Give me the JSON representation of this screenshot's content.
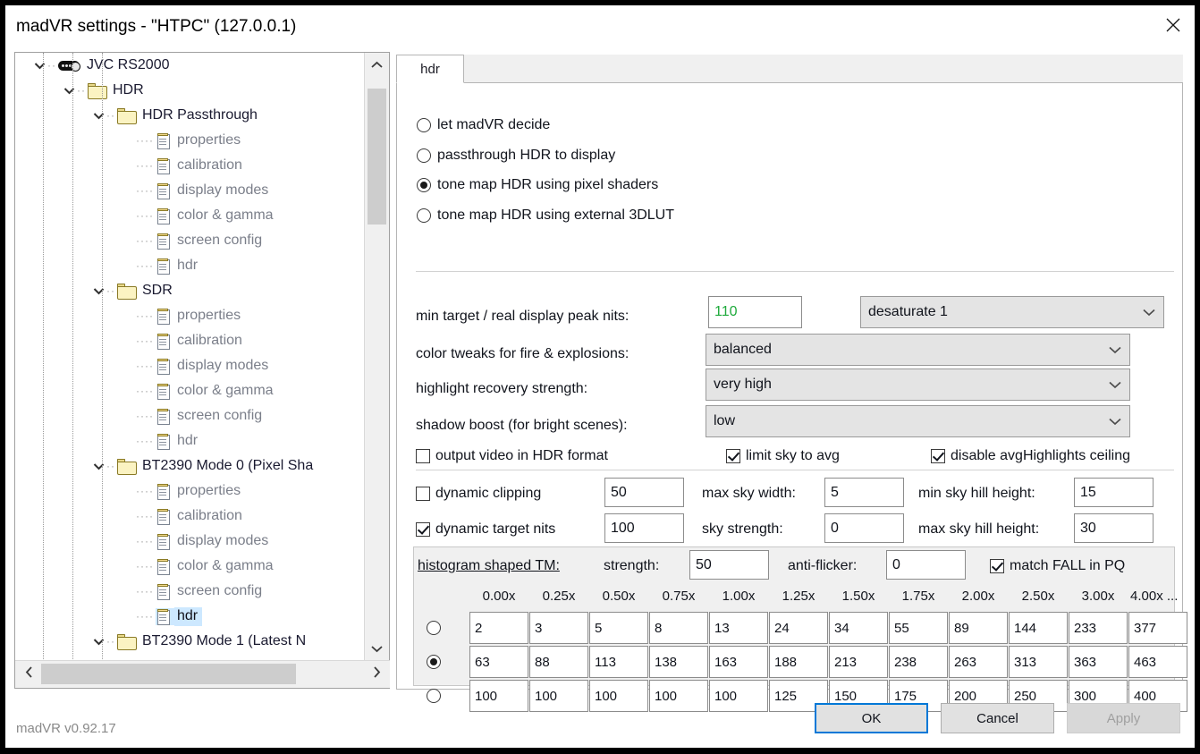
{
  "window": {
    "title": "madVR settings - \"HTPC\" (127.0.0.1)",
    "close_icon": "close-icon"
  },
  "tree": {
    "items": [
      {
        "label": "JVC RS2000",
        "depth": 1,
        "icon": "projector-icon",
        "expanded": true,
        "type": "device",
        "selected": false
      },
      {
        "label": "HDR",
        "depth": 2,
        "icon": "folder-icon",
        "expanded": true,
        "type": "folder",
        "selected": false
      },
      {
        "label": "HDR Passthrough",
        "depth": 3,
        "icon": "folder-icon",
        "expanded": true,
        "type": "folder",
        "selected": false
      },
      {
        "label": "properties",
        "depth": 4,
        "icon": "document-icon",
        "expanded": null,
        "type": "leaf",
        "selected": false
      },
      {
        "label": "calibration",
        "depth": 4,
        "icon": "document-icon",
        "expanded": null,
        "type": "leaf",
        "selected": false
      },
      {
        "label": "display modes",
        "depth": 4,
        "icon": "document-icon",
        "expanded": null,
        "type": "leaf",
        "selected": false
      },
      {
        "label": "color & gamma",
        "depth": 4,
        "icon": "document-icon",
        "expanded": null,
        "type": "leaf",
        "selected": false
      },
      {
        "label": "screen config",
        "depth": 4,
        "icon": "document-icon",
        "expanded": null,
        "type": "leaf",
        "selected": false
      },
      {
        "label": "hdr",
        "depth": 4,
        "icon": "document-icon",
        "expanded": null,
        "type": "leaf",
        "selected": false
      },
      {
        "label": "SDR",
        "depth": 3,
        "icon": "folder-icon",
        "expanded": true,
        "type": "folder",
        "selected": false
      },
      {
        "label": "properties",
        "depth": 4,
        "icon": "document-icon",
        "expanded": null,
        "type": "leaf",
        "selected": false
      },
      {
        "label": "calibration",
        "depth": 4,
        "icon": "document-icon",
        "expanded": null,
        "type": "leaf",
        "selected": false
      },
      {
        "label": "display modes",
        "depth": 4,
        "icon": "document-icon",
        "expanded": null,
        "type": "leaf",
        "selected": false
      },
      {
        "label": "color & gamma",
        "depth": 4,
        "icon": "document-icon",
        "expanded": null,
        "type": "leaf",
        "selected": false
      },
      {
        "label": "screen config",
        "depth": 4,
        "icon": "document-icon",
        "expanded": null,
        "type": "leaf",
        "selected": false
      },
      {
        "label": "hdr",
        "depth": 4,
        "icon": "document-icon",
        "expanded": null,
        "type": "leaf",
        "selected": false
      },
      {
        "label": "BT2390 Mode 0 (Pixel Sha",
        "depth": 3,
        "icon": "folder-icon",
        "expanded": true,
        "type": "folder",
        "selected": false
      },
      {
        "label": "properties",
        "depth": 4,
        "icon": "document-icon",
        "expanded": null,
        "type": "leaf",
        "selected": false
      },
      {
        "label": "calibration",
        "depth": 4,
        "icon": "document-icon",
        "expanded": null,
        "type": "leaf",
        "selected": false
      },
      {
        "label": "display modes",
        "depth": 4,
        "icon": "document-icon",
        "expanded": null,
        "type": "leaf",
        "selected": false
      },
      {
        "label": "color & gamma",
        "depth": 4,
        "icon": "document-icon",
        "expanded": null,
        "type": "leaf",
        "selected": false
      },
      {
        "label": "screen config",
        "depth": 4,
        "icon": "document-icon",
        "expanded": null,
        "type": "leaf",
        "selected": false
      },
      {
        "label": "hdr",
        "depth": 4,
        "icon": "document-icon",
        "expanded": null,
        "type": "leaf",
        "selected": true
      },
      {
        "label": "BT2390 Mode 1 (Latest N",
        "depth": 3,
        "icon": "folder-icon",
        "expanded": true,
        "type": "folder",
        "selected": false
      }
    ]
  },
  "tab": {
    "label": "hdr"
  },
  "hdr_mode": {
    "options": [
      {
        "label": "let madVR decide",
        "selected": false
      },
      {
        "label": "passthrough HDR to display",
        "selected": false
      },
      {
        "label": "tone map HDR using pixel shaders",
        "selected": true
      },
      {
        "label": "tone map HDR using external 3DLUT",
        "selected": false
      }
    ]
  },
  "fields": {
    "min_target": {
      "label": "min target / real display peak nits:",
      "value": "110",
      "value_color": "#1faa3c",
      "desaturate": {
        "value": "desaturate 1"
      }
    },
    "color_tweaks": {
      "label": "color tweaks for fire & explosions:",
      "value": "balanced"
    },
    "highlight_recovery": {
      "label": "highlight recovery strength:",
      "value": "very high"
    },
    "shadow_boost": {
      "label": "shadow boost (for bright scenes):",
      "value": "low"
    }
  },
  "toggles": {
    "output_hdr": {
      "label": "output video in HDR format",
      "checked": false
    },
    "limit_sky": {
      "label": "limit sky to avg",
      "checked": true
    },
    "disable_ceiling": {
      "label": "disable avgHighlights ceiling",
      "checked": true
    },
    "dynamic_clipping": {
      "label": "dynamic clipping",
      "checked": false,
      "value": "50"
    },
    "dynamic_target": {
      "label": "dynamic target nits",
      "checked": true,
      "value": "100"
    }
  },
  "sky": {
    "max_sky_width": {
      "label": "max sky width:",
      "value": "5"
    },
    "sky_strength": {
      "label": "sky strength:",
      "value": "0"
    },
    "min_sky_hill": {
      "label": "min sky hill height:",
      "value": "15"
    },
    "max_sky_hill": {
      "label": "max sky hill height:",
      "value": "30"
    }
  },
  "histogram": {
    "link_label": "histogram shaped TM:",
    "strength": {
      "label": "strength:",
      "value": "50"
    },
    "anti_flicker": {
      "label": "anti-flicker:",
      "value": "0"
    },
    "match_fall": {
      "label": "match FALL in PQ",
      "checked": true
    },
    "columns": [
      "0.00x",
      "0.25x",
      "0.50x",
      "0.75x",
      "1.00x",
      "1.25x",
      "1.50x",
      "1.75x",
      "2.00x",
      "2.50x",
      "3.00x",
      "4.00x ..."
    ],
    "rows": [
      {
        "selected": false,
        "values": [
          "2",
          "3",
          "5",
          "8",
          "13",
          "24",
          "34",
          "55",
          "89",
          "144",
          "233",
          "377"
        ]
      },
      {
        "selected": true,
        "values": [
          "63",
          "88",
          "113",
          "138",
          "163",
          "188",
          "213",
          "238",
          "263",
          "313",
          "363",
          "463"
        ]
      },
      {
        "selected": false,
        "values": [
          "100",
          "100",
          "100",
          "100",
          "100",
          "125",
          "150",
          "175",
          "200",
          "250",
          "300",
          "400"
        ]
      }
    ]
  },
  "footer": {
    "version": "madVR v0.92.17",
    "ok": "OK",
    "cancel": "Cancel",
    "apply": "Apply"
  }
}
